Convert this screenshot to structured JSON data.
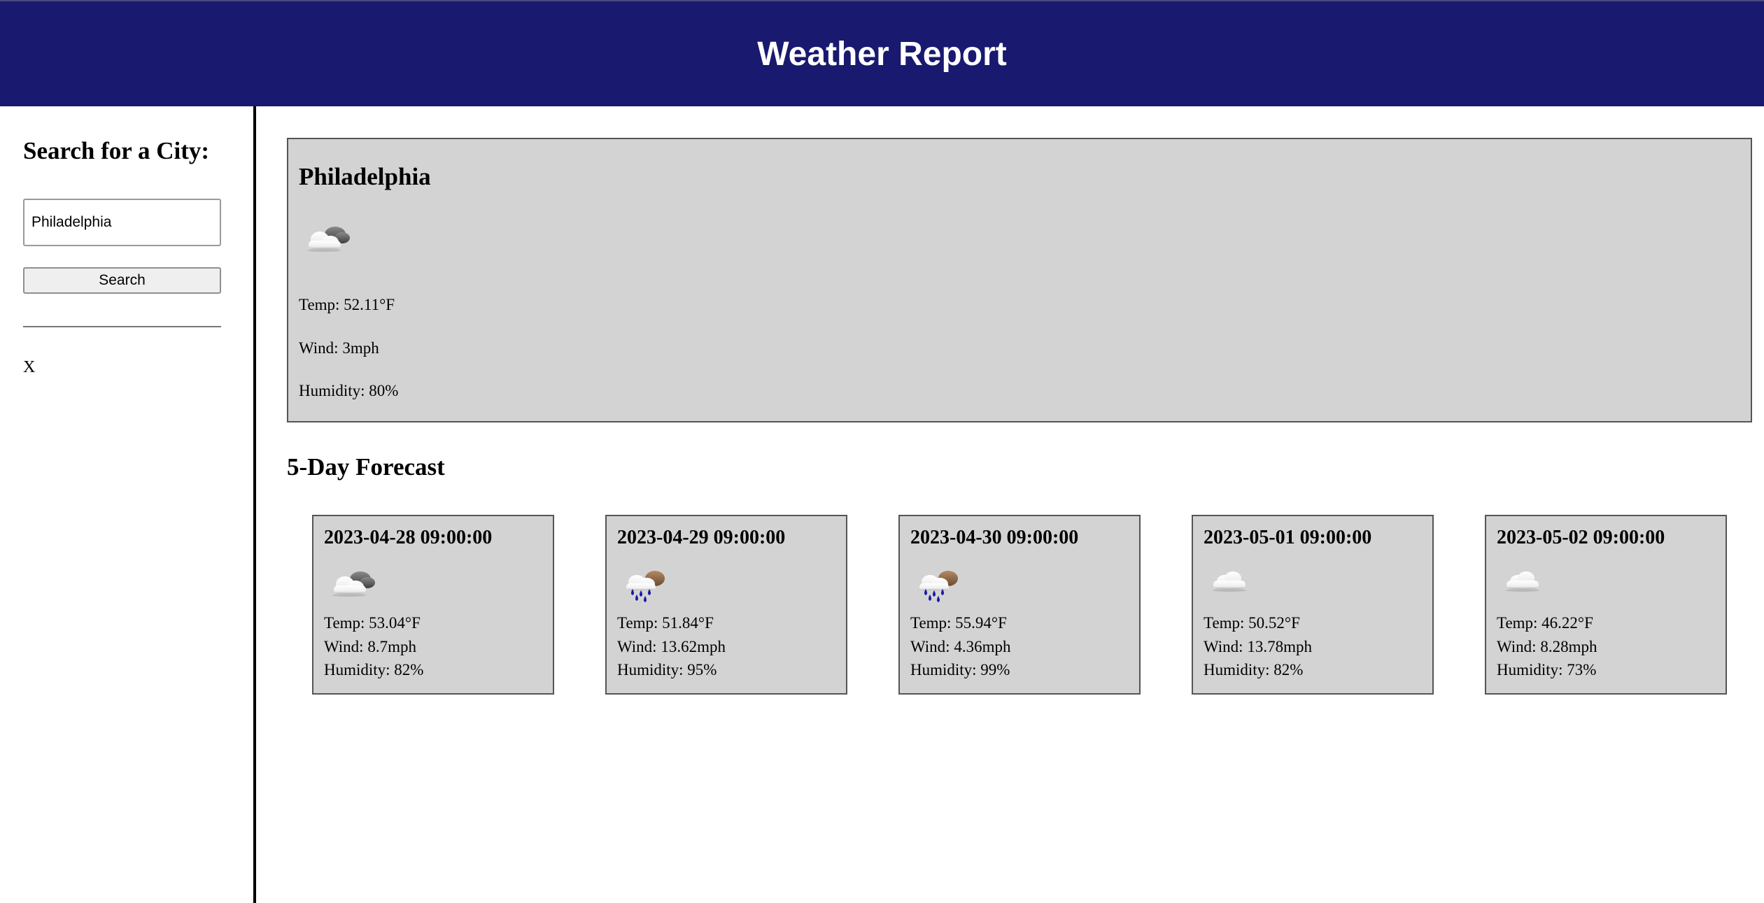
{
  "header": {
    "title": "Weather Report"
  },
  "sidebar": {
    "heading": "Search for a City:",
    "search_value": "Philadelphia",
    "search_label": "Search",
    "history": [
      "X"
    ]
  },
  "current": {
    "city": "Philadelphia",
    "icon": "partly-cloudy-icon",
    "temp": "Temp: 52.11°F",
    "wind": "Wind: 3mph",
    "humidity": "Humidity: 80%"
  },
  "forecast": {
    "title": "5-Day Forecast",
    "days": [
      {
        "date": "2023-04-28 09:00:00",
        "icon": "partly-cloudy-icon",
        "temp": "Temp: 53.04°F",
        "wind": "Wind: 8.7mph",
        "humidity": "Humidity: 82%"
      },
      {
        "date": "2023-04-29 09:00:00",
        "icon": "rain-icon",
        "temp": "Temp: 51.84°F",
        "wind": "Wind: 13.62mph",
        "humidity": "Humidity: 95%"
      },
      {
        "date": "2023-04-30 09:00:00",
        "icon": "rain-icon",
        "temp": "Temp: 55.94°F",
        "wind": "Wind: 4.36mph",
        "humidity": "Humidity: 99%"
      },
      {
        "date": "2023-05-01 09:00:00",
        "icon": "cloud-icon",
        "temp": "Temp: 50.52°F",
        "wind": "Wind: 13.78mph",
        "humidity": "Humidity: 82%"
      },
      {
        "date": "2023-05-02 09:00:00",
        "icon": "cloud-icon",
        "temp": "Temp: 46.22°F",
        "wind": "Wind: 8.28mph",
        "humidity": "Humidity: 73%"
      }
    ]
  }
}
